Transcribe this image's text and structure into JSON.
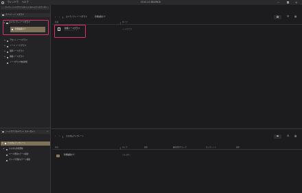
{
  "menubar": {
    "items": [
      "ウィンドウ",
      "ヘルプ"
    ],
    "title": "CS 6.1.0.3800RC8"
  },
  "left_panel": {
    "tab_label": "ナーバー ノードグラフ ステージ ステージナービゲーター",
    "header": "ナーバー ノードグラフ",
    "tree": [
      "エンティティノードグラフ",
      "新規編集オブ",
      "アセットノードグラフ",
      "ノード ノードグラフ",
      "選択ノードグラフ",
      "通路ノードグラフ",
      "ノードグラフ作成状態"
    ],
    "bottom_header": "ノードグラフステウント ステーガイド",
    "bottom_tree": [
      "カスタムテンプレート",
      "カスタム新規登録",
      "ツール登録ステージ検索",
      "ブレイク登録ステージ検索"
    ]
  },
  "top_browser": {
    "breadcrumb": [
      "エンティティノードグラフ",
      "新規編集オブ"
    ],
    "columns": [
      "名前",
      "タイプ"
    ],
    "row": {
      "name": "新規ノードグラフ",
      "sub": "エンティティノード",
      "type": "ノードグラフ"
    }
  },
  "bottom_browser": {
    "breadcrumb": [
      "カスタムテンプレート"
    ],
    "columns": [
      "名前",
      "タイプ",
      "更新",
      "最終更新グループ",
      "ロックノード",
      "更新"
    ],
    "row": {
      "name": "新規編集オブ",
      "type": "フォルダー"
    }
  },
  "colors": {
    "highlight": "#e0316e",
    "accent_tan": "#8a7a5a"
  }
}
